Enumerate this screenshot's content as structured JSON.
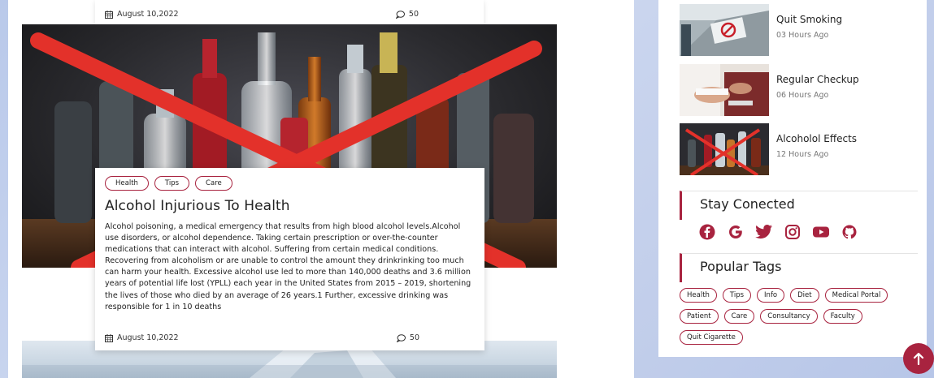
{
  "top_card": {
    "date": "August 10,2022",
    "comments": "50"
  },
  "article": {
    "tags": [
      "Health",
      "Tips",
      "Care"
    ],
    "title": "Alcohol Injurious To Health",
    "body": "Alcohol poisoning, a medical emergency that results from high blood alcohol levels.Alcohol use disorders, or alcohol dependence. Taking certain prescription or over-the-counter medications that can interact with alcohol. Suffering from certain medical conditions. Recovering from alcoholism or are unable to control the amount they drinkrinking too much can harm your health. Excessive alcohol use led to more than 140,000 deaths and 3.6 million years of potential life lost (YPLL) each year in the United States from 2015 – 2019, shortening the lives of those who died by an average of 26 years.1 Further, excessive drinking was responsible for 1 in 10 deaths",
    "date": "August 10,2022",
    "comments": "50"
  },
  "sidebar": {
    "recent_posts": [
      {
        "title": "Quit Smoking",
        "time": "03 Hours Ago"
      },
      {
        "title": "Regular Checkup",
        "time": "06 Hours Ago"
      },
      {
        "title": "Alcoholol Effects",
        "time": "12 Hours Ago"
      }
    ],
    "stay_connected": {
      "title": "Stay Conected",
      "icons": [
        "facebook-icon",
        "google-icon",
        "twitter-icon",
        "instagram-icon",
        "youtube-icon",
        "github-icon"
      ]
    },
    "popular_tags": {
      "title": "Popular Tags",
      "tags": [
        "Health",
        "Tips",
        "Info",
        "Diet",
        "Medical Portal",
        "Patient",
        "Care",
        "Consultancy",
        "Faculty",
        "Quit Cigarette"
      ]
    }
  },
  "colors": {
    "accent": "#a8233f",
    "background": "#c3cfeb"
  }
}
